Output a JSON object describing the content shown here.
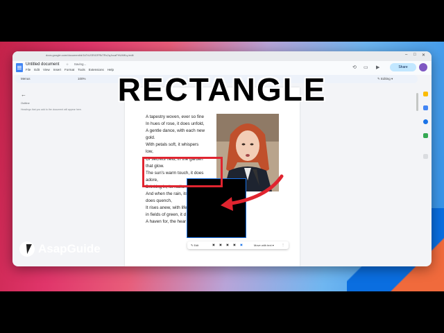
{
  "browser": {
    "url": "docs.google.com/document/d/1kTrUSRIGFRkTRx2qJvcaFHUMKq-/edit"
  },
  "doc": {
    "title": "Untitled document",
    "status": "Saving...",
    "menus": [
      "File",
      "Edit",
      "View",
      "Insert",
      "Format",
      "Tools",
      "Extensions",
      "Help"
    ],
    "share_label": "Share",
    "toolbar": {
      "search_label": "Menus",
      "zoom": "100%",
      "mode": "Editing"
    }
  },
  "outline": {
    "label": "Outline",
    "hint": "Headings that you add to the document will appear here."
  },
  "poem": [
    "A tapestry woven, ever so fine",
    "In hues of rose, it does unfold,",
    "A gentle dance, with each new",
    "gold.",
    "With petals soft, it whispers",
    "low,",
    "Of secrets held, in the garden",
    "that glow.",
    "The sun's warm touch, it does",
    "adore,",
    "Drinking in, its radiance",
    "And when the rain, its thirst",
    "does quench,",
    "It rises anew, with life",
    "in fields of green, it d",
    "A haven for, the hear"
  ],
  "image_toolbar": {
    "edit_label": "Edit",
    "wrap_label": "Move with text"
  },
  "overlay": {
    "headline": "RECTANGLE",
    "brand": "AsapGuide"
  },
  "colors": {
    "highlight": "#e0242f",
    "share_bg": "#c2e7ff",
    "docs_blue": "#4285f4"
  }
}
